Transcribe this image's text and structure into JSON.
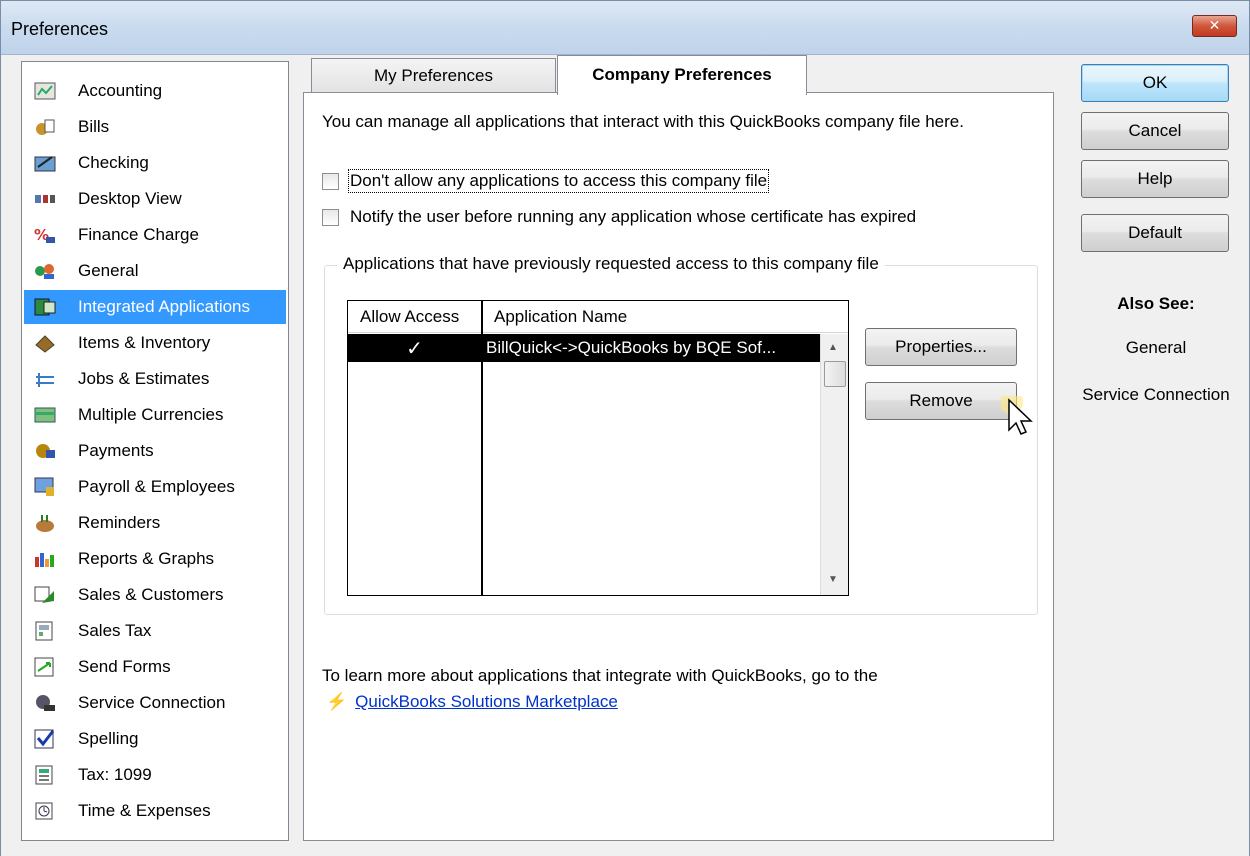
{
  "window": {
    "title": "Preferences",
    "close_label": "✕"
  },
  "sidebar": {
    "items": [
      {
        "label": "Accounting",
        "icon": "accounting-icon"
      },
      {
        "label": "Bills",
        "icon": "bills-icon"
      },
      {
        "label": "Checking",
        "icon": "checking-icon"
      },
      {
        "label": "Desktop View",
        "icon": "desktop-view-icon"
      },
      {
        "label": "Finance Charge",
        "icon": "finance-charge-icon"
      },
      {
        "label": "General",
        "icon": "general-icon"
      },
      {
        "label": "Integrated Applications",
        "icon": "integrated-applications-icon",
        "selected": true
      },
      {
        "label": "Items & Inventory",
        "icon": "items-inventory-icon"
      },
      {
        "label": "Jobs & Estimates",
        "icon": "jobs-estimates-icon"
      },
      {
        "label": "Multiple Currencies",
        "icon": "multiple-currencies-icon"
      },
      {
        "label": "Payments",
        "icon": "payments-icon"
      },
      {
        "label": "Payroll & Employees",
        "icon": "payroll-employees-icon"
      },
      {
        "label": "Reminders",
        "icon": "reminders-icon"
      },
      {
        "label": "Reports & Graphs",
        "icon": "reports-graphs-icon"
      },
      {
        "label": "Sales & Customers",
        "icon": "sales-customers-icon"
      },
      {
        "label": "Sales Tax",
        "icon": "sales-tax-icon"
      },
      {
        "label": "Send Forms",
        "icon": "send-forms-icon"
      },
      {
        "label": "Service Connection",
        "icon": "service-connection-icon"
      },
      {
        "label": "Spelling",
        "icon": "spelling-icon"
      },
      {
        "label": "Tax: 1099",
        "icon": "tax-1099-icon"
      },
      {
        "label": "Time & Expenses",
        "icon": "time-expenses-icon"
      }
    ]
  },
  "tabs": {
    "my_preferences": "My Preferences",
    "company_preferences": "Company Preferences",
    "active": "company_preferences"
  },
  "content": {
    "description": "You can manage all applications that interact with this QuickBooks company file here.",
    "checkbox_dont_allow": {
      "label": "Don't allow any applications to access this company file",
      "checked": false
    },
    "checkbox_notify": {
      "label": "Notify the user before running any application whose certificate has expired",
      "checked": false
    },
    "group_title": "Applications that have previously requested access to this company file",
    "list": {
      "columns": [
        "Allow Access",
        "Application Name"
      ],
      "rows": [
        {
          "allow_access": "✓",
          "application_name": "BillQuick<->QuickBooks by BQE Sof..."
        }
      ]
    },
    "properties_button": "Properties...",
    "remove_button": "Remove",
    "learn_more_text": "To learn more about applications that integrate with QuickBooks, go to the",
    "marketplace_link": "QuickBooks Solutions Marketplace"
  },
  "buttons": {
    "ok": "OK",
    "cancel": "Cancel",
    "help": "Help",
    "default": "Default"
  },
  "also_see": {
    "title": "Also See:",
    "links": [
      "General",
      "Service Connection"
    ]
  }
}
